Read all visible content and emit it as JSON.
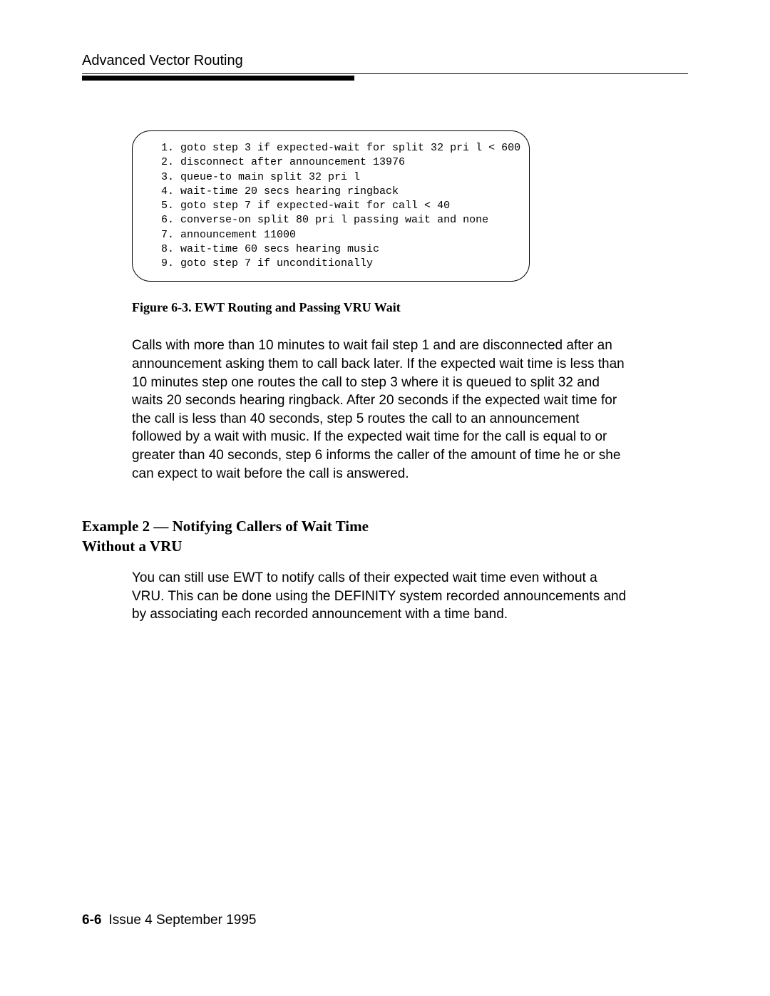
{
  "header": {
    "title": "Advanced Vector Routing"
  },
  "code_box": {
    "lines": [
      "1. goto step 3 if expected-wait for split 32 pri l < 600",
      "2. disconnect after announcement 13976",
      "3. queue-to main split 32 pri l",
      "4. wait-time 20 secs hearing ringback",
      "5. goto step 7 if expected-wait for call < 40",
      "6. converse-on split 80 pri l passing wait and none",
      "7. announcement 11000",
      "8. wait-time 60 secs hearing music",
      "9. goto step 7 if unconditionally"
    ]
  },
  "figure_caption": "Figure 6-3.   EWT Routing and Passing VRU Wait",
  "paragraph1": "Calls with more than 10 minutes to wait fail step 1 and are disconnected after an announcement asking them to call back later. If the expected wait time is less than 10 minutes step one routes the call to step 3 where it is queued to split 32 and waits 20 seconds hearing ringback. After 20 seconds if the expected wait time for the call is less than 40 seconds, step 5 routes the call to an announcement followed by a wait with music. If the expected wait time for the call is equal to or greater than 40 seconds, step 6 informs the caller of the amount of time he or she can expect to wait before the call is answered.",
  "section_heading": "Example 2 — Notifying Callers of Wait Time Without a VRU",
  "paragraph2": "You can still use EWT to notify calls of their expected wait time even without a VRU. This can be done using the DEFINITY system recorded announcements and by associating each recorded announcement with a time band.",
  "footer": {
    "page_number": "6-6",
    "issue_text": "Issue  4 September 1995"
  }
}
